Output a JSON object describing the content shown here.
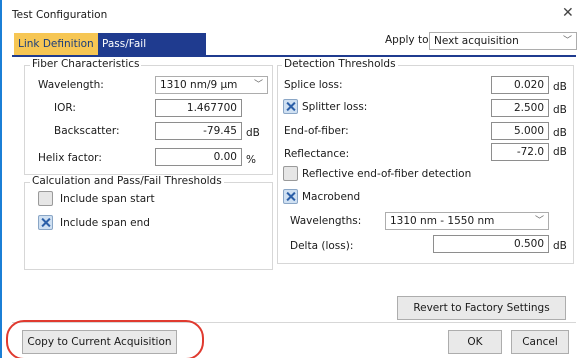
{
  "window": {
    "title": "Test Configuration"
  },
  "tabs": [
    {
      "label": "Link Definition"
    },
    {
      "label": "Pass/Fail Thresholds"
    }
  ],
  "apply_to": {
    "label": "Apply to:",
    "value": "Next acquisition"
  },
  "fiber": {
    "legend": "Fiber Characteristics",
    "wavelength_label": "Wavelength:",
    "wavelength_value": "1310 nm/9 µm",
    "ior_label": "IOR:",
    "ior_value": "1.467700",
    "backscatter_label": "Backscatter:",
    "backscatter_value": "-79.45",
    "backscatter_unit": "dB",
    "helix_label": "Helix factor:",
    "helix_value": "0.00",
    "helix_unit": "%"
  },
  "calc": {
    "legend": "Calculation and Pass/Fail Thresholds",
    "span_start_label": "Include span start",
    "span_start_checked": false,
    "span_end_label": "Include span end",
    "span_end_checked": true
  },
  "detection": {
    "legend": "Detection Thresholds",
    "splice_label": "Splice loss:",
    "splice_value": "0.020",
    "splice_unit": "dB",
    "splitter_label": "Splitter loss:",
    "splitter_checked": true,
    "splitter_value": "2.500",
    "splitter_unit": "dB",
    "eof_label": "End-of-fiber:",
    "eof_value": "5.000",
    "eof_unit": "dB",
    "reflectance_label": "Reflectance:",
    "reflectance_value": "-72.0",
    "reflectance_unit": "dB",
    "reflective_eof_label": "Reflective end-of-fiber detection",
    "reflective_eof_checked": false,
    "macrobend_label": "Macrobend",
    "macrobend_checked": true,
    "wavelengths_label": "Wavelengths:",
    "wavelengths_value": "1310 nm - 1550 nm",
    "delta_label": "Delta (loss):",
    "delta_value": "0.500",
    "delta_unit": "dB"
  },
  "buttons": {
    "revert": "Revert to Factory Settings",
    "copy": "Copy to Current Acquisition",
    "ok": "OK",
    "cancel": "Cancel"
  },
  "colors": {
    "tab_active_bg": "#f6c654",
    "tab_inactive_bg": "#1f3b8f",
    "highlight": "#e03a2f",
    "window_border": "#1b7fd6"
  }
}
